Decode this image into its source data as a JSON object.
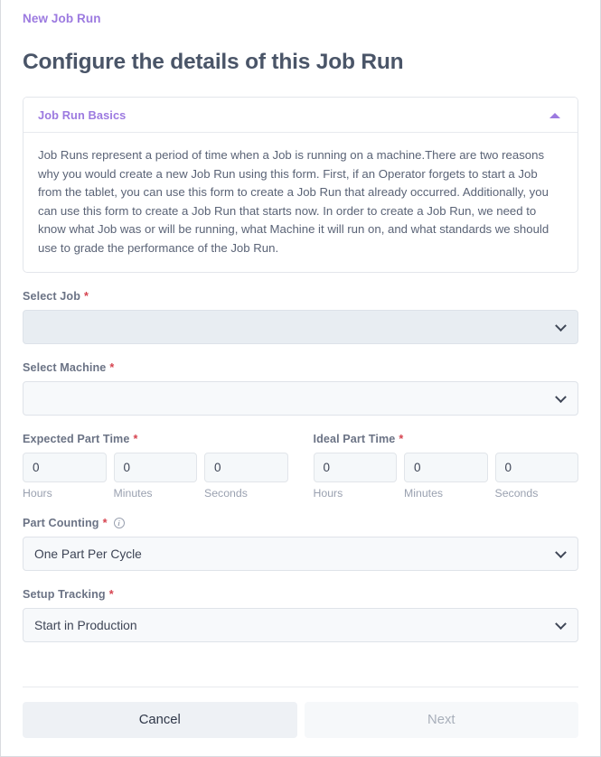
{
  "breadcrumb": {
    "label": "New Job Run"
  },
  "page": {
    "title": "Configure the details of this Job Run"
  },
  "panel": {
    "title": "Job Run Basics",
    "toggle_icon": "caret-up-icon",
    "body": "Job Runs represent a period of time when a Job is running on a machine.There are two reasons why you would create a new Job Run using this form. First, if an Operator forgets to start a Job from the tablet, you can use this form to create a Job Run that already occurred. Additionally, you can use this form to create a Job Run that starts now. In order to create a Job Run, we need to know what Job was or will be running, what Machine it will run on, and what standards we should use to grade the performance of the Job Run."
  },
  "fields": {
    "select_job": {
      "label": "Select Job",
      "required": "*",
      "value": "",
      "icon": "chevron-down-icon"
    },
    "select_machine": {
      "label": "Select Machine",
      "required": "*",
      "value": "",
      "icon": "chevron-down-icon"
    },
    "expected_part_time": {
      "label": "Expected Part Time",
      "required": "*",
      "units": [
        {
          "caption": "Hours",
          "value": "0"
        },
        {
          "caption": "Minutes",
          "value": "0"
        },
        {
          "caption": "Seconds",
          "value": "0"
        }
      ]
    },
    "ideal_part_time": {
      "label": "Ideal Part Time",
      "required": "*",
      "units": [
        {
          "caption": "Hours",
          "value": "0"
        },
        {
          "caption": "Minutes",
          "value": "0"
        },
        {
          "caption": "Seconds",
          "value": "0"
        }
      ]
    },
    "part_counting": {
      "label": "Part Counting",
      "required": "*",
      "info_icon": "info-icon",
      "info_glyph": "i",
      "value": "One Part Per Cycle",
      "icon": "chevron-down-icon"
    },
    "setup_tracking": {
      "label": "Setup Tracking",
      "required": "*",
      "value": "Start in Production",
      "icon": "chevron-down-icon"
    }
  },
  "footer": {
    "cancel_label": "Cancel",
    "next_label": "Next"
  },
  "colors": {
    "accent_purple": "#9c7ae0",
    "heading": "#4a5568",
    "required_red": "#d6434f",
    "label": "#6b7385"
  }
}
